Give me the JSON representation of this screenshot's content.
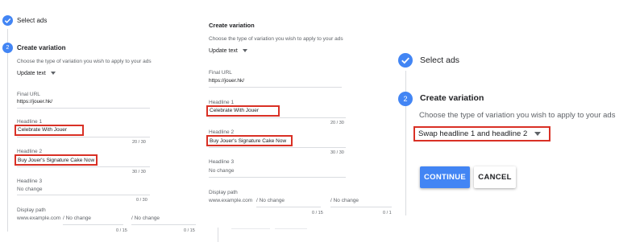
{
  "colors": {
    "accent": "#4285f4",
    "highlight": "#d93025",
    "divider": "#dadce0"
  },
  "panel1": {
    "step1": {
      "label": "Select ads",
      "icon": "check-circle-icon"
    },
    "step2": {
      "number": "2",
      "label": "Create variation"
    },
    "description": "Choose the type of variation you wish to apply to your ads",
    "dropdown": "Update text",
    "final_url_label": "Final URL",
    "final_url_value": "https://jouer.hk/",
    "headline1_label": "Headline 1",
    "headline1_value": "Celebrate With Jouer",
    "headline1_count": "20 / 30",
    "headline2_label": "Headline 2",
    "headline2_value": "Buy Jouer's Signature Cake Now",
    "headline2_count": "30 / 30",
    "headline3_label": "Headline 3",
    "headline3_value": "No change",
    "headline3_count": "0 / 30",
    "display_path_label": "Display path",
    "display_path_domain": "www.example.com",
    "path1_value": "/  No change",
    "path2_value": "/  No change",
    "path1_count": "0 / 15",
    "path2_count": "0 / 15"
  },
  "panel2": {
    "title": "Create variation",
    "description": "Choose the type of variation you wish to apply to your ads",
    "dropdown": "Update text",
    "final_url_label": "Final URL",
    "final_url_value": "https://jouer.hk/",
    "headline1_label": "Headline 1",
    "headline1_value": "Celebrate With Jouer",
    "headline1_count": "20 / 30",
    "headline2_label": "Headline 2",
    "headline2_value": "Buy Jouer's Signature Cake Now",
    "headline2_count": "30 / 30",
    "headline3_label": "Headline 3",
    "headline3_value": "No change",
    "display_path_label": "Display path",
    "display_path_domain": "www.example.com",
    "path1_value": "/  No change",
    "path2_value": "/  No change",
    "path1_count": "0 / 15",
    "path2_count": "0 / 1"
  },
  "panel3": {
    "step1": {
      "label": "Select ads",
      "icon": "check-circle-icon"
    },
    "step2": {
      "number": "2",
      "label": "Create variation"
    },
    "description": "Choose the type of variation you wish to apply to your ads",
    "dropdown": "Swap headline 1 and headline 2",
    "continue_label": "CONTINUE",
    "cancel_label": "CANCEL"
  }
}
